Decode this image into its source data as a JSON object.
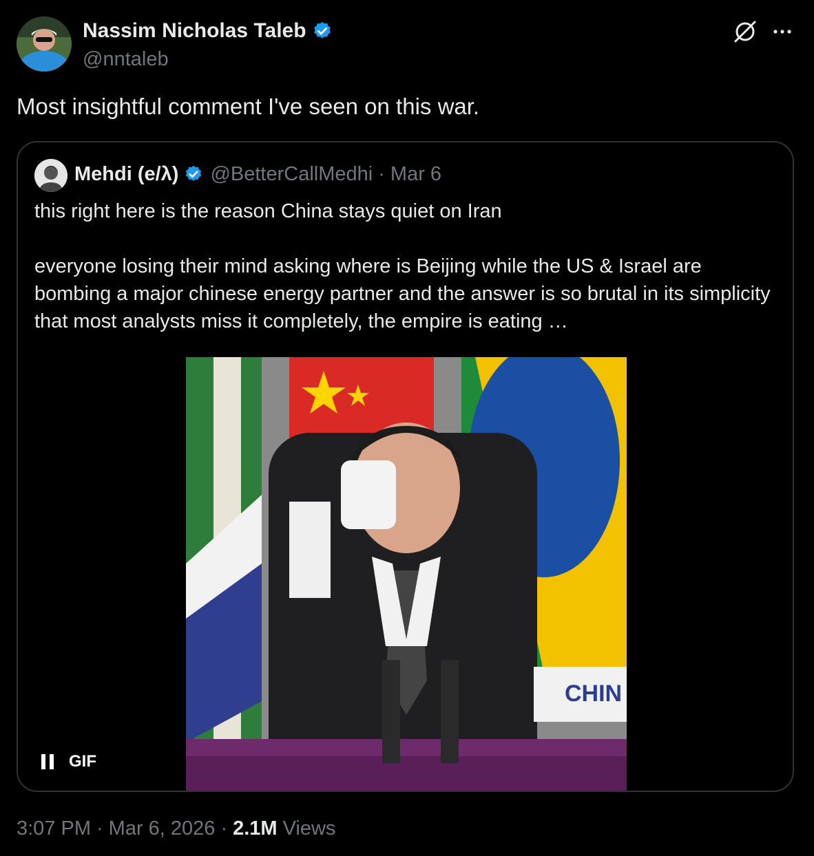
{
  "author": {
    "name": "Nassim Nicholas Taleb",
    "handle": "@nntaleb",
    "verified_icon": "verified-badge-icon",
    "accent": "#1d9bf0"
  },
  "toolbar": {
    "grok_icon": "grok-icon",
    "more_icon": "more-icon",
    "more_glyph": "···"
  },
  "tweet": {
    "text": "Most insightful comment I've seen on this war."
  },
  "quoted": {
    "name": "Mehdi (e/λ)",
    "handle": "@BetterCallMedhi",
    "separator": "·",
    "date": "Mar 6",
    "line1": "this right here is the reason China stays quiet on Iran",
    "line2": "everyone losing their mind asking where is Beijing while the US & Israel are bombing a major chinese energy partner and the answer is so brutal in its simplicity that most analysts miss it completely, the empire is eating  …",
    "media": {
      "overlay_text": "CHIN",
      "gif_label": "GIF",
      "pause_icon": "pause-icon"
    }
  },
  "meta": {
    "time": "3:07 PM",
    "separator1": "·",
    "date": "Mar 6, 2026",
    "separator2": "·",
    "views_count": "2.1M",
    "views_label": "Views"
  }
}
